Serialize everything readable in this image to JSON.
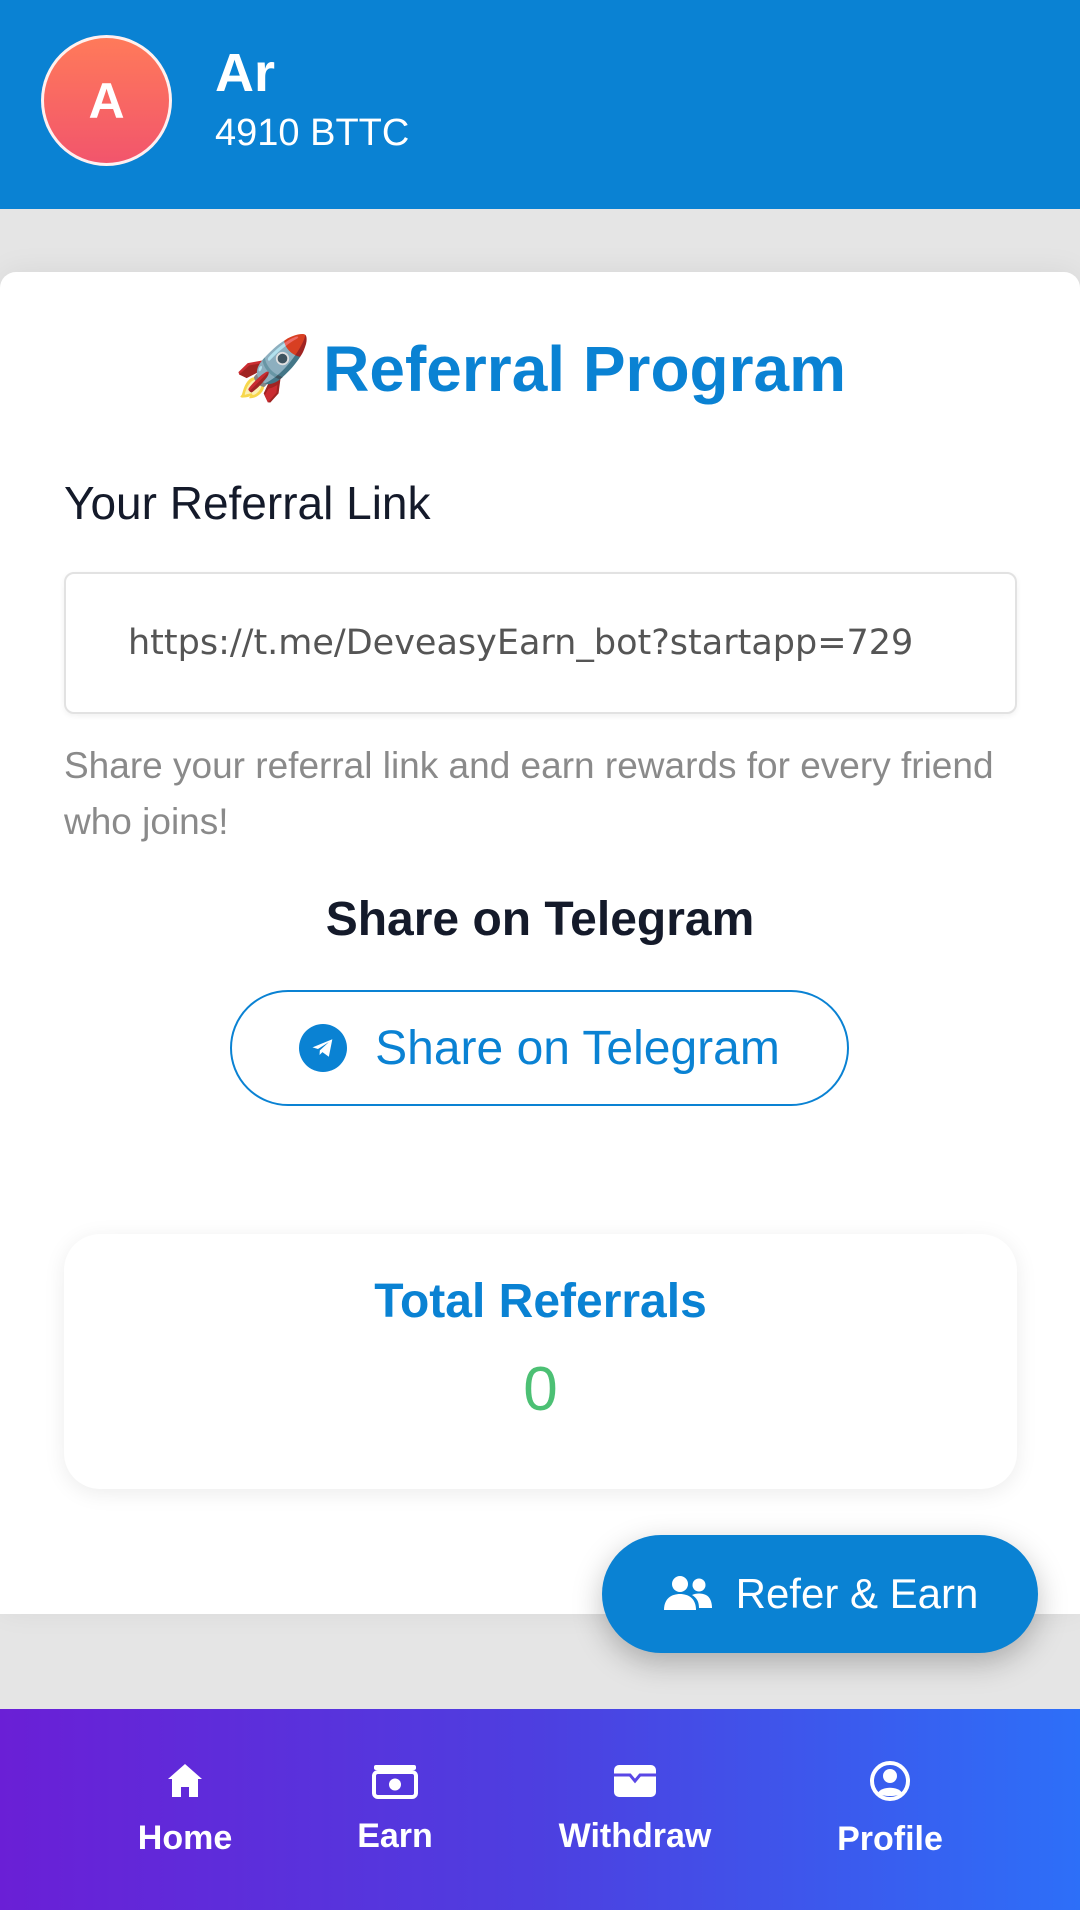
{
  "header": {
    "avatar_initial": "A",
    "user_name": "Ar",
    "balance": "4910 BTTC"
  },
  "referral": {
    "title": "Referral Program",
    "rocket_icon": "🚀",
    "link_label": "Your Referral Link",
    "link_value": "https://t.me/DeveasyEarn_bot?startapp=729",
    "help_text": "Share your referral link and earn rewards for every friend who joins!",
    "share_heading": "Share on Telegram",
    "share_button_label": "Share on Telegram"
  },
  "stats": {
    "label": "Total Referrals",
    "value": "0"
  },
  "fab": {
    "label": "Refer & Earn",
    "icon": "users-icon"
  },
  "nav": {
    "items": [
      {
        "label": "Home",
        "icon": "home-icon"
      },
      {
        "label": "Earn",
        "icon": "money-icon"
      },
      {
        "label": "Withdraw",
        "icon": "wallet-icon"
      },
      {
        "label": "Profile",
        "icon": "user-circle-icon"
      }
    ]
  },
  "colors": {
    "primary": "#0a82d3",
    "success": "#4cc074",
    "nav_gradient_start": "#6a1fd6",
    "nav_gradient_end": "#2d6ff8"
  }
}
